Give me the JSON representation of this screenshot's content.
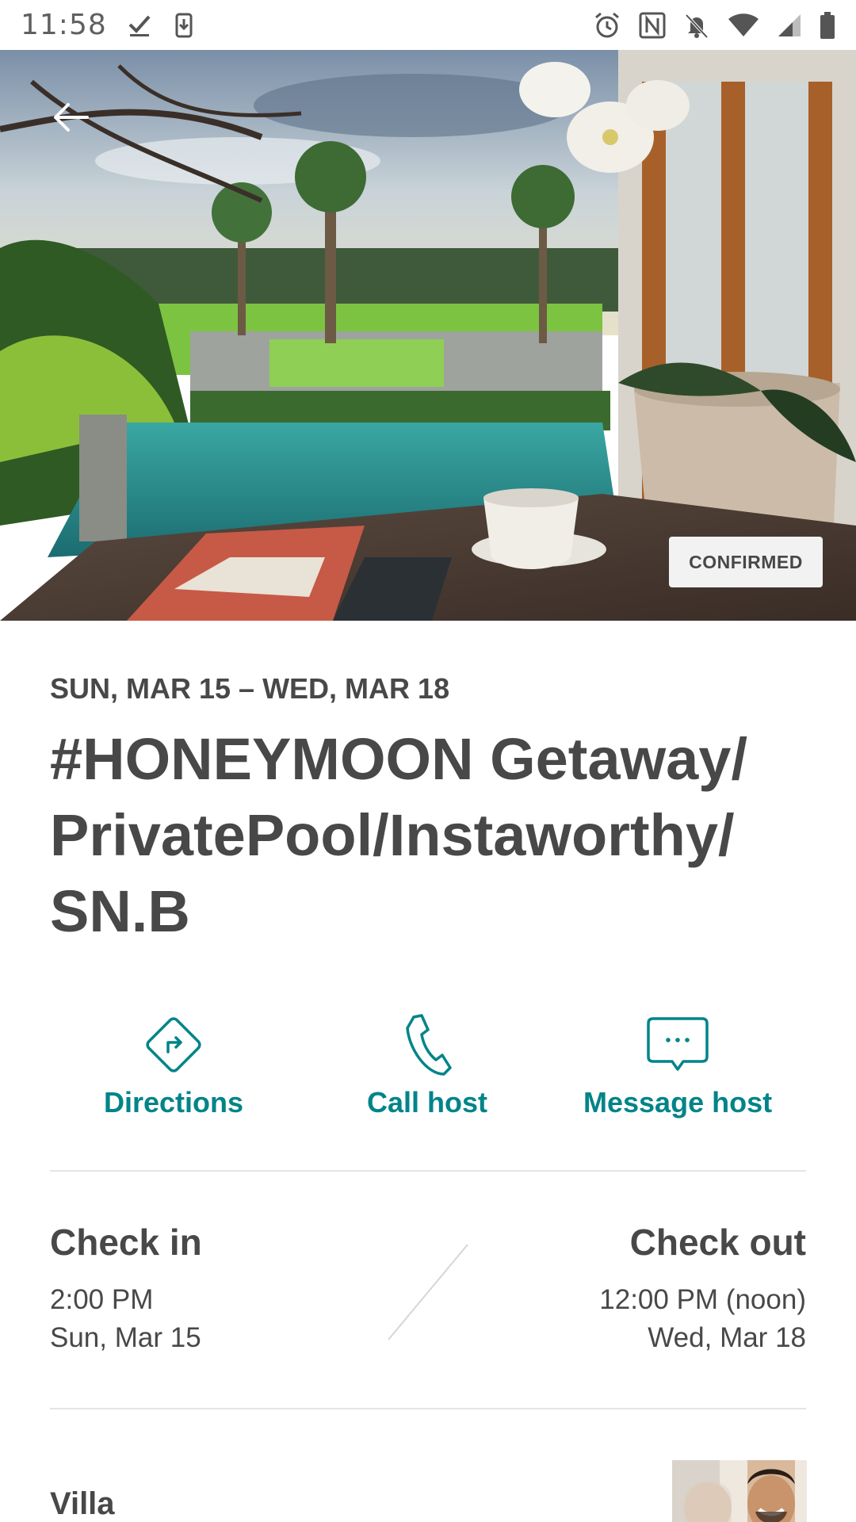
{
  "status_bar": {
    "time": "11:58",
    "left_icons": [
      "download-done-icon",
      "phone-download-icon"
    ],
    "right_icons": [
      "alarm-icon",
      "nfc-icon",
      "notifications-off-icon",
      "wifi-icon",
      "cellular-signal-icon",
      "battery-icon"
    ]
  },
  "hero": {
    "back_icon": "arrow-left-icon",
    "status_badge": "CONFIRMED"
  },
  "reservation": {
    "dates": "SUN, MAR 15 – WED, MAR 18",
    "title": "#HONEYMOON Getaway/ PrivatePool/Instaworthy/ SN.B"
  },
  "actions": [
    {
      "label": "Directions",
      "icon": "directions-icon"
    },
    {
      "label": "Call host",
      "icon": "phone-icon"
    },
    {
      "label": "Message host",
      "icon": "chat-bubble-icon"
    }
  ],
  "check_in": {
    "heading": "Check in",
    "time": "2:00 PM",
    "date": "Sun, Mar 15"
  },
  "check_out": {
    "heading": "Check out",
    "time": "12:00 PM (noon)",
    "date": "Wed, Mar 18"
  },
  "property": {
    "type": "Villa"
  },
  "colors": {
    "accent": "#008489",
    "text": "#484848",
    "divider": "#e4e4e4",
    "badge_bg": "#f2f2f2"
  }
}
